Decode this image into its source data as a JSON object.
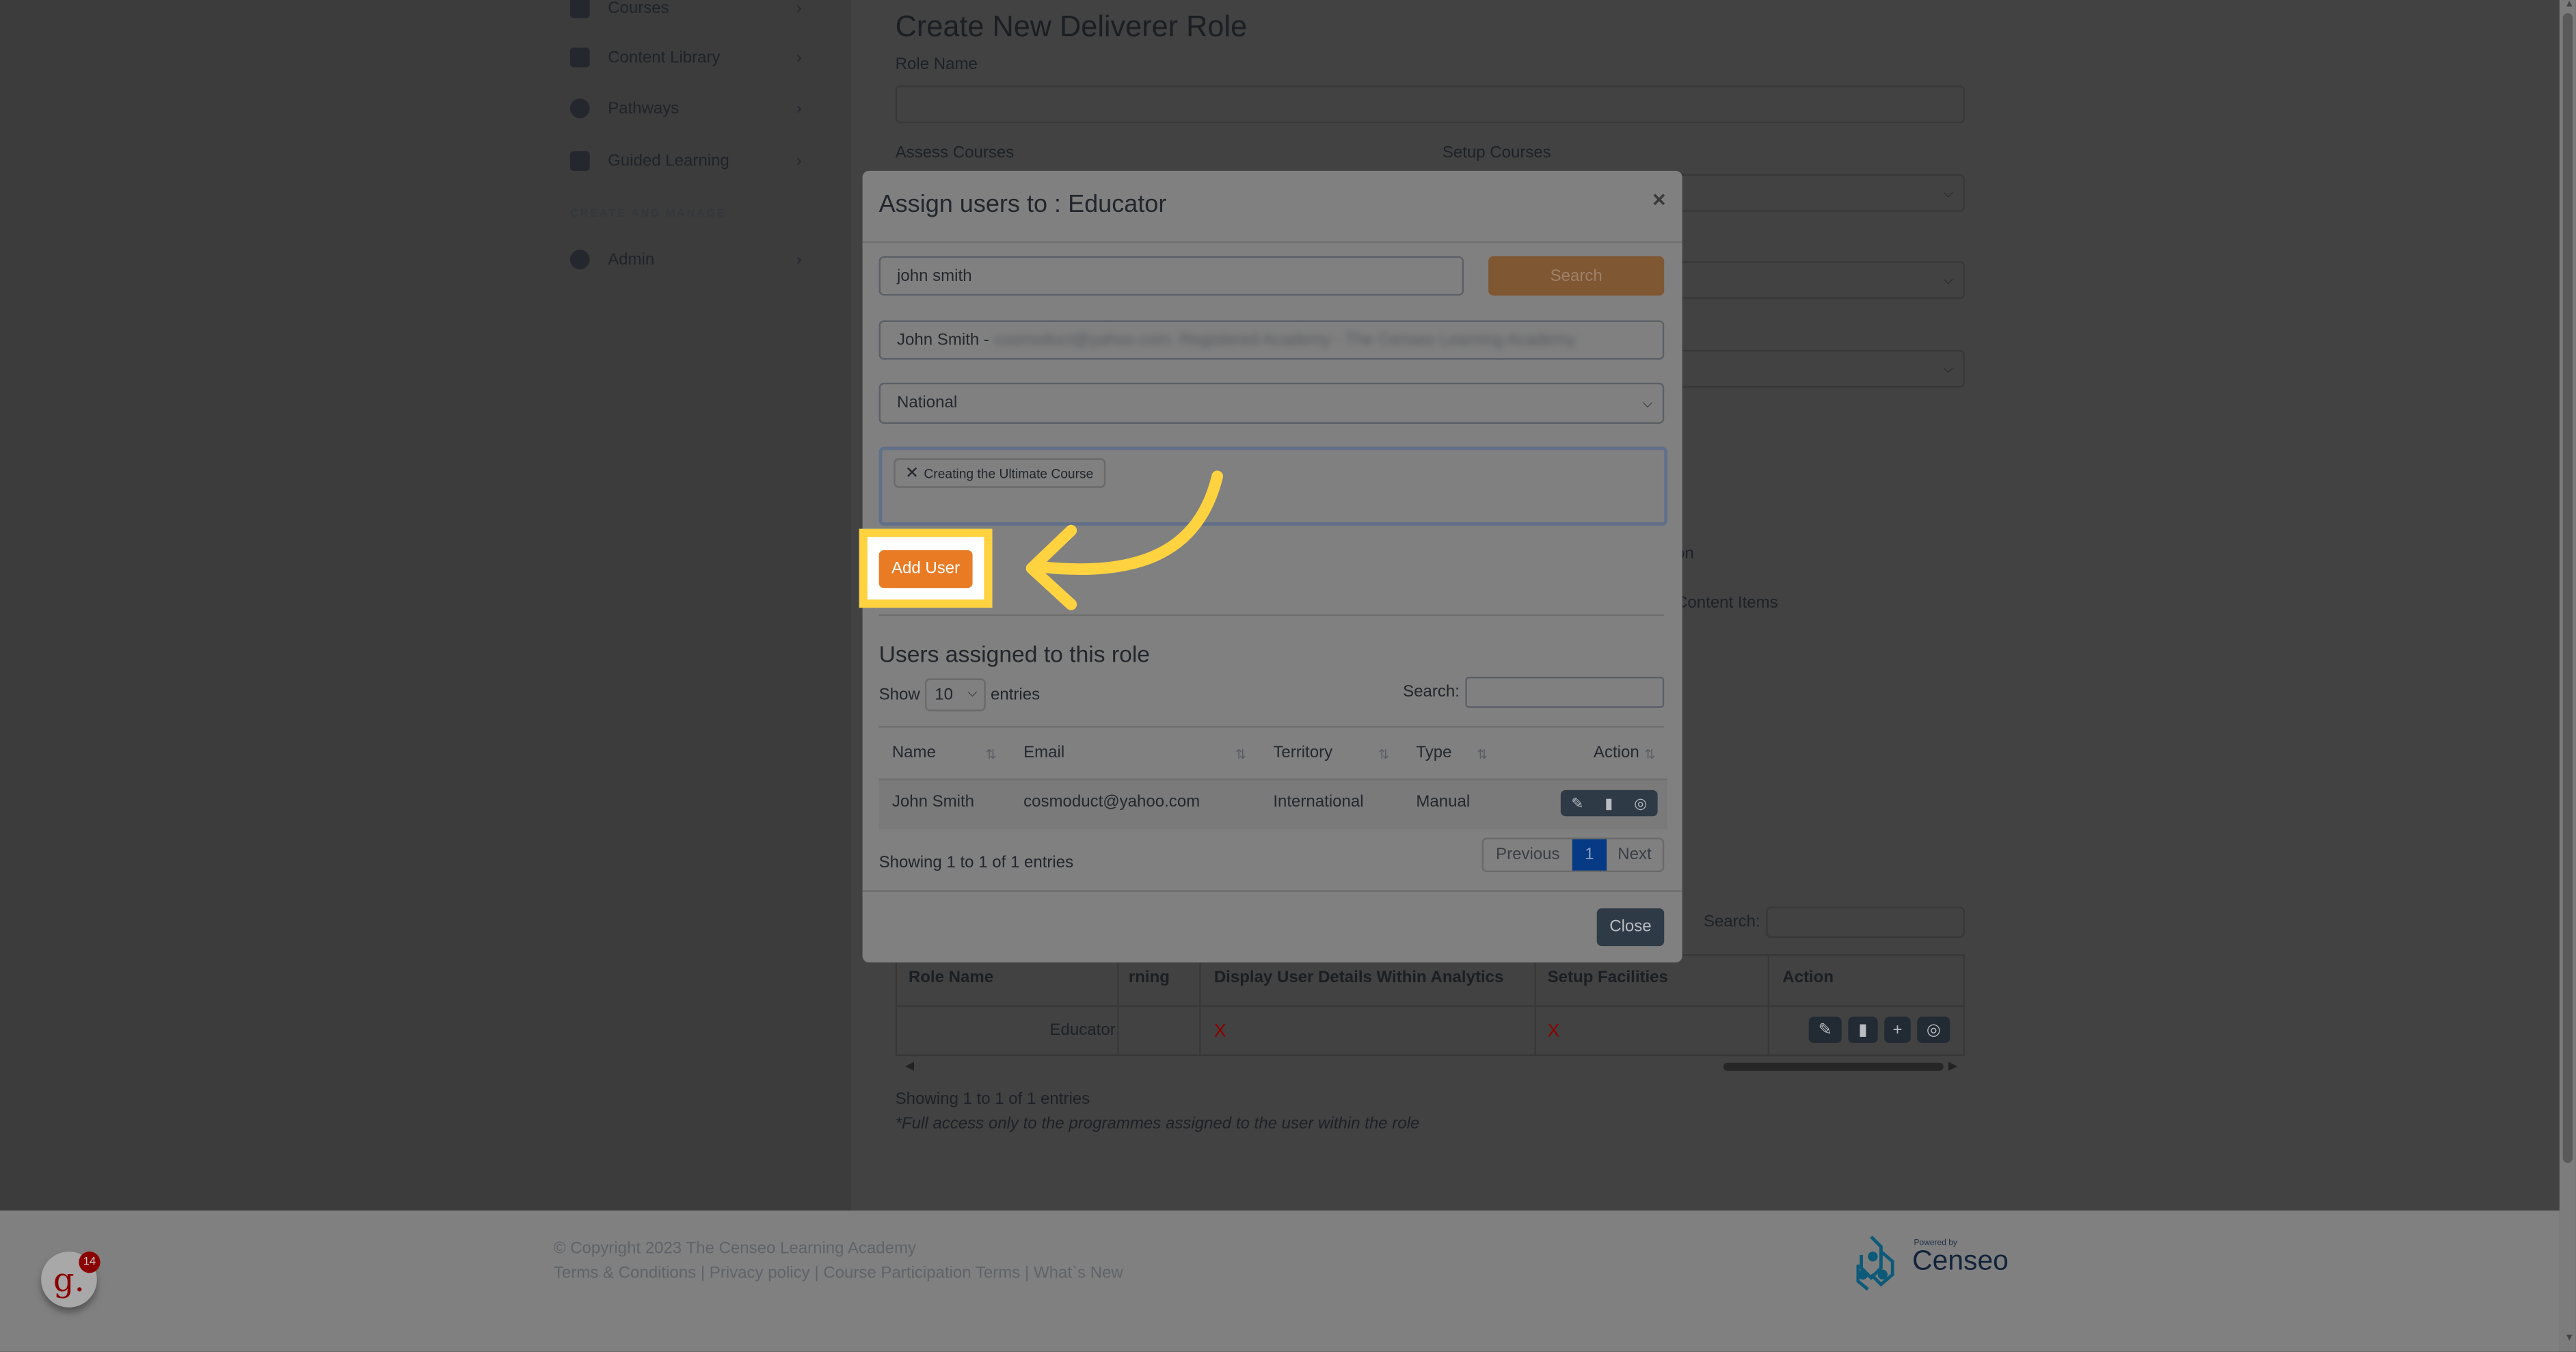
{
  "sidebar": {
    "items": [
      {
        "label": "Courses",
        "icon": "courses-icon"
      },
      {
        "label": "Content Library",
        "icon": "book-icon"
      },
      {
        "label": "Pathways",
        "icon": "award-icon"
      },
      {
        "label": "Guided Learning",
        "icon": "clipboard-list-icon"
      }
    ],
    "section": "CREATE AND MANAGE",
    "admin": {
      "label": "Admin",
      "icon": "gear-icon"
    }
  },
  "page": {
    "title": "Create New Deliverer Role",
    "role_name_label": "Role Name",
    "role_name_value": "",
    "assess_label": "Assess Courses",
    "setup_label": "Setup Courses",
    "partial_label_1": "on",
    "partial_label_2": "Content Items"
  },
  "roles_table": {
    "search_label": "Search:",
    "columns": [
      "Role Name",
      "rning",
      "Display User Details Within Analytics",
      "Setup Facilities",
      "Action"
    ],
    "rows": [
      {
        "role": "Educator",
        "display": "X",
        "setup": "X"
      }
    ],
    "info": "Showing 1 to 1 of 1 entries",
    "note": "*Full access only to the programmes assigned to the user within the role"
  },
  "modal": {
    "title": "Assign users to : Educator",
    "close_x": "×",
    "search_value": "john smith",
    "search_button": "Search",
    "user_select": "John Smith - ",
    "user_select_blurred": "cosmoduct@yahoo.com, Registered Academy - The Censeo Learning Academy",
    "territory_select": "National",
    "tag": "Creating the Ultimate Course",
    "add_user": "Add User",
    "users_heading": "Users assigned to this role",
    "show": "Show",
    "entries_value": "10",
    "entries": "entries",
    "search_label": "Search:",
    "columns": [
      "Name",
      "Email",
      "Territory",
      "Type",
      "Action"
    ],
    "rows": [
      {
        "name": "John Smith",
        "email": "cosmoduct@yahoo.com",
        "territory": "International",
        "type": "Manual"
      }
    ],
    "info": "Showing 1 to 1 of 1 entries",
    "previous": "Previous",
    "page": "1",
    "next": "Next",
    "close_button": "Close"
  },
  "footer": {
    "copyright": "© Copyright 2023 The Censeo Learning Academy",
    "links": [
      "Terms & Conditions",
      "Privacy policy",
      "Course Participation Terms",
      "What`s New"
    ],
    "badge_count": "14",
    "badge_letter": "g.",
    "powered_by": "Powered by",
    "brand": "Censeo"
  },
  "colors": {
    "accent_orange": "#e97b25",
    "highlight_yellow": "#ffd23f",
    "page_active": "#063a85",
    "x_red": "#8b0000"
  }
}
